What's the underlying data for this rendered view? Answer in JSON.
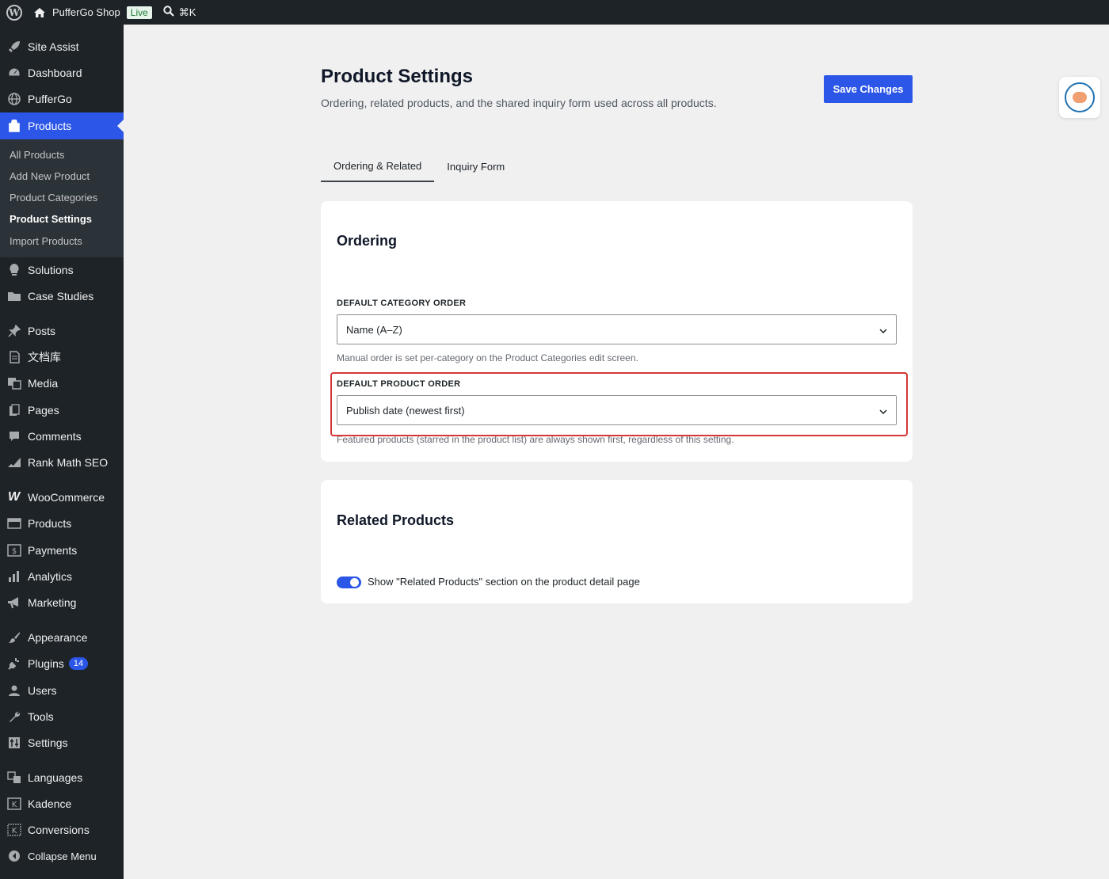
{
  "admin_bar": {
    "site_name": "PufferGo Shop",
    "status_badge": "Live",
    "shortcut": "⌘K"
  },
  "sidebar": {
    "items": [
      {
        "label": "Site Assist",
        "icon": "rocket-icon"
      },
      {
        "label": "Dashboard",
        "icon": "dashboard-icon"
      },
      {
        "label": "PufferGo",
        "icon": "globe-icon"
      },
      {
        "label": "Products",
        "icon": "products-icon",
        "current": true
      },
      {
        "label": "Solutions",
        "icon": "lightbulb-icon"
      },
      {
        "label": "Case Studies",
        "icon": "folder-icon"
      },
      {
        "label": "Posts",
        "icon": "pin-icon"
      },
      {
        "label": "文档库",
        "icon": "document-icon"
      },
      {
        "label": "Media",
        "icon": "media-icon"
      },
      {
        "label": "Pages",
        "icon": "pages-icon"
      },
      {
        "label": "Comments",
        "icon": "comment-icon"
      },
      {
        "label": "Rank Math SEO",
        "icon": "chart-icon"
      },
      {
        "label": "WooCommerce",
        "icon": "woocommerce-icon"
      },
      {
        "label": "Products",
        "icon": "archive-icon"
      },
      {
        "label": "Payments",
        "icon": "payments-icon"
      },
      {
        "label": "Analytics",
        "icon": "analytics-icon"
      },
      {
        "label": "Marketing",
        "icon": "megaphone-icon"
      },
      {
        "label": "Appearance",
        "icon": "brush-icon"
      },
      {
        "label": "Plugins",
        "icon": "plug-icon",
        "badge": "14"
      },
      {
        "label": "Users",
        "icon": "user-icon"
      },
      {
        "label": "Tools",
        "icon": "wrench-icon"
      },
      {
        "label": "Settings",
        "icon": "sliders-icon"
      },
      {
        "label": "Languages",
        "icon": "translate-icon"
      },
      {
        "label": "Kadence",
        "icon": "kadence-icon"
      },
      {
        "label": "Conversions",
        "icon": "conversions-icon"
      },
      {
        "label": "Collapse Menu",
        "icon": "collapse-icon"
      }
    ],
    "submenu": [
      {
        "label": "All Products"
      },
      {
        "label": "Add New Product"
      },
      {
        "label": "Product Categories"
      },
      {
        "label": "Product Settings",
        "current": true
      },
      {
        "label": "Import Products"
      }
    ]
  },
  "page": {
    "title": "Product Settings",
    "subtitle": "Ordering, related products, and the shared inquiry form used across all products.",
    "save_label": "Save Changes"
  },
  "tabs": [
    {
      "label": "Ordering & Related",
      "active": true
    },
    {
      "label": "Inquiry Form",
      "active": false
    }
  ],
  "ordering": {
    "heading": "Ordering",
    "category_order": {
      "label": "DEFAULT CATEGORY ORDER",
      "value": "Name (A–Z)",
      "help": "Manual order is set per-category on the Product Categories edit screen."
    },
    "product_order": {
      "label": "DEFAULT PRODUCT ORDER",
      "value": "Publish date (newest first)",
      "help": "Featured products (starred in the product list) are always shown first, regardless of this setting."
    }
  },
  "related": {
    "heading": "Related Products",
    "toggle_on": true,
    "toggle_label": "Show \"Related Products\" section on the product detail page"
  },
  "colors": {
    "accent": "#2c56e7",
    "sidebar_bg": "#1d2327",
    "highlight_border": "#d63638"
  }
}
